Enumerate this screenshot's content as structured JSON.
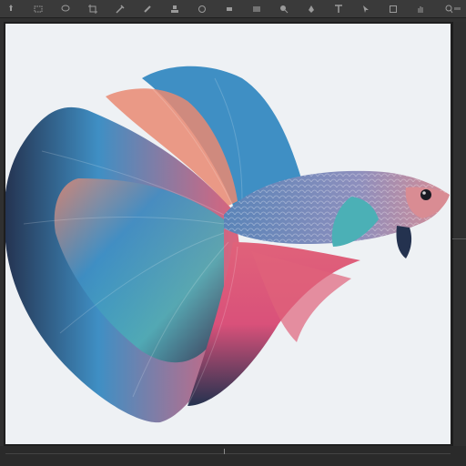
{
  "toolbar": {
    "tools": [
      {
        "icon": "move-tool-icon"
      },
      {
        "icon": "marquee-tool-icon"
      },
      {
        "icon": "lasso-tool-icon"
      },
      {
        "icon": "crop-tool-icon"
      },
      {
        "icon": "eyedropper-tool-icon"
      },
      {
        "icon": "brush-tool-icon"
      },
      {
        "icon": "stamp-tool-icon"
      },
      {
        "icon": "history-brush-icon"
      },
      {
        "icon": "eraser-tool-icon"
      },
      {
        "icon": "gradient-tool-icon"
      },
      {
        "icon": "dodge-tool-icon"
      },
      {
        "icon": "pen-tool-icon"
      },
      {
        "icon": "type-tool-icon"
      },
      {
        "icon": "path-select-icon"
      },
      {
        "icon": "shape-tool-icon"
      },
      {
        "icon": "hand-tool-icon"
      },
      {
        "icon": "zoom-tool-icon"
      }
    ]
  },
  "canvas": {
    "image": "betta-fish-illustration",
    "background_color": "#eef1f4"
  },
  "colors": {
    "fin_blue": "#3f8fc4",
    "fin_teal": "#4bb0b6",
    "fin_pink": "#e0627a",
    "fin_coral": "#e98a72",
    "fin_navy": "#24324f",
    "body_blue": "#5a84b8",
    "body_pink": "#d98c93"
  }
}
